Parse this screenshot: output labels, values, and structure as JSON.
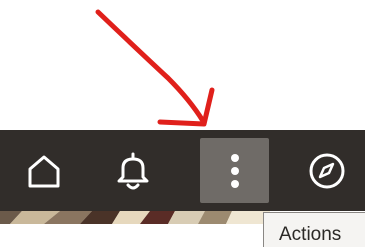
{
  "toolbar": {
    "home_button": {
      "icon": "home-icon"
    },
    "notifications_button": {
      "icon": "bell-icon"
    },
    "actions_button": {
      "icon": "vertical-ellipsis-icon",
      "state": "hovered"
    },
    "navigator_button": {
      "icon": "compass-icon"
    }
  },
  "tooltip": {
    "text": "Actions"
  },
  "annotation": {
    "arrow_color": "#e0201b"
  },
  "colors": {
    "toolbar_bg": "#312d2a",
    "hover_bg": "#6f6b67",
    "icon": "#ffffff"
  }
}
